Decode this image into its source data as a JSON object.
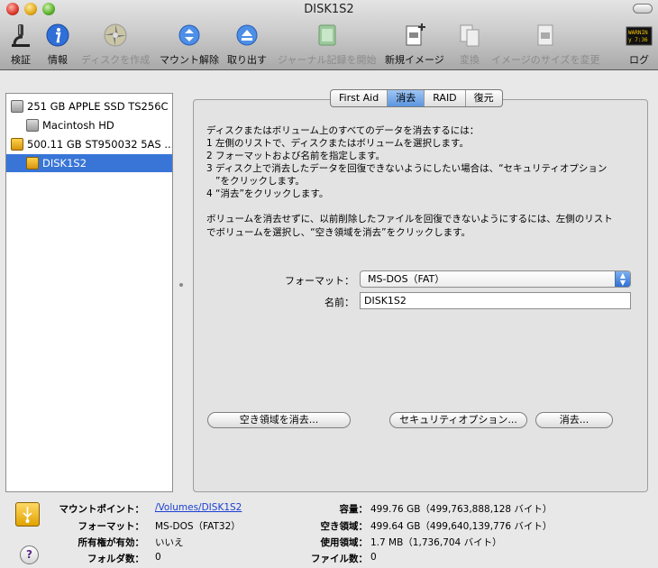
{
  "window": {
    "title": "DISK1S2"
  },
  "toolbar": {
    "verify": "検証",
    "info": "情報",
    "burn": "ディスクを作成",
    "unmount": "マウント解除",
    "eject": "取り出す",
    "journal": "ジャーナル記録を開始",
    "new_image": "新規イメージ",
    "convert": "変換",
    "resize": "イメージのサイズを変更",
    "log": "ログ",
    "log_badge": "WARNIN"
  },
  "sidebar": {
    "items": [
      {
        "label": "251 GB APPLE SSD TS256C"
      },
      {
        "label": "Macintosh HD"
      },
      {
        "label": "500.11 GB ST950032 5AS ..."
      },
      {
        "label": "DISK1S2"
      }
    ]
  },
  "tabs": [
    "First Aid",
    "消去",
    "RAID",
    "復元"
  ],
  "erase": {
    "instructions": [
      "ディスクまたはボリューム上のすべてのデータを消去するには：",
      "1  左側のリストで、ディスクまたはボリュームを選択します。",
      "2  フォーマットおよび名前を指定します。",
      "3  ディスク上で消去したデータを回復できないようにしたい場合は、“セキュリティオプション",
      "”をクリックします。",
      "4  “消去”をクリックします。"
    ],
    "note_line1": "ボリュームを消去せずに、以前削除したファイルを回復できないようにするには、左側のリスト",
    "note_line2": "でボリュームを選択し、“空き領域を消去”をクリックします。",
    "format_label": "フォーマット：",
    "format_value": "MS-DOS（FAT）",
    "name_label": "名前：",
    "name_value": "DISK1S2",
    "erase_free_button": "空き領域を消去...",
    "security_button": "セキュリティオプション...",
    "erase_button": "消去..."
  },
  "info": {
    "mount_point_label": "マウントポイント：",
    "mount_point_value": "/Volumes/DISK1S2",
    "format_label": "フォーマット：",
    "format_value": "MS-DOS（FAT32）",
    "owners_label": "所有権が有効：",
    "owners_value": "いいえ",
    "folders_label": "フォルダ数：",
    "folders_value": "0",
    "capacity_label": "容量：",
    "capacity_value": "499.76 GB（499,763,888,128 バイト）",
    "available_label": "空き領域：",
    "available_value": "499.64 GB（499,640,139,776 バイト）",
    "used_label": "使用領域：",
    "used_value": "1.7 MB（1,736,704 バイト）",
    "files_label": "ファイル数：",
    "files_value": "0"
  },
  "help_glyph": "?"
}
